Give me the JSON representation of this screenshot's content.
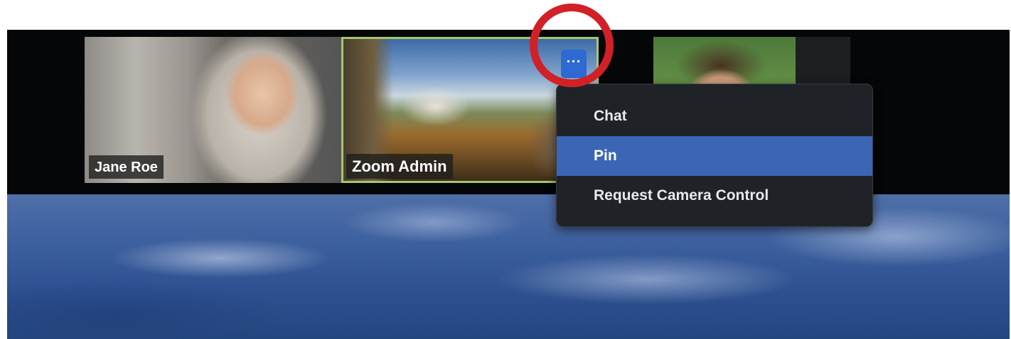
{
  "participants": [
    {
      "name": "Jane Roe"
    },
    {
      "name": "Zoom Admin",
      "active_speaker": true
    },
    {
      "name": ""
    }
  ],
  "more_button": {
    "label": "···",
    "icon": "ellipsis-icon"
  },
  "context_menu": {
    "items": [
      {
        "label": "Chat"
      },
      {
        "label": "Pin",
        "highlighted": true
      },
      {
        "label": "Request Camera Control"
      }
    ]
  },
  "colors": {
    "active_border": "#a6c76a",
    "menu_highlight": "#3a66b5",
    "menu_background": "#1f2226",
    "more_button": "#2d6ad1",
    "annotation_ring": "#d12127"
  }
}
